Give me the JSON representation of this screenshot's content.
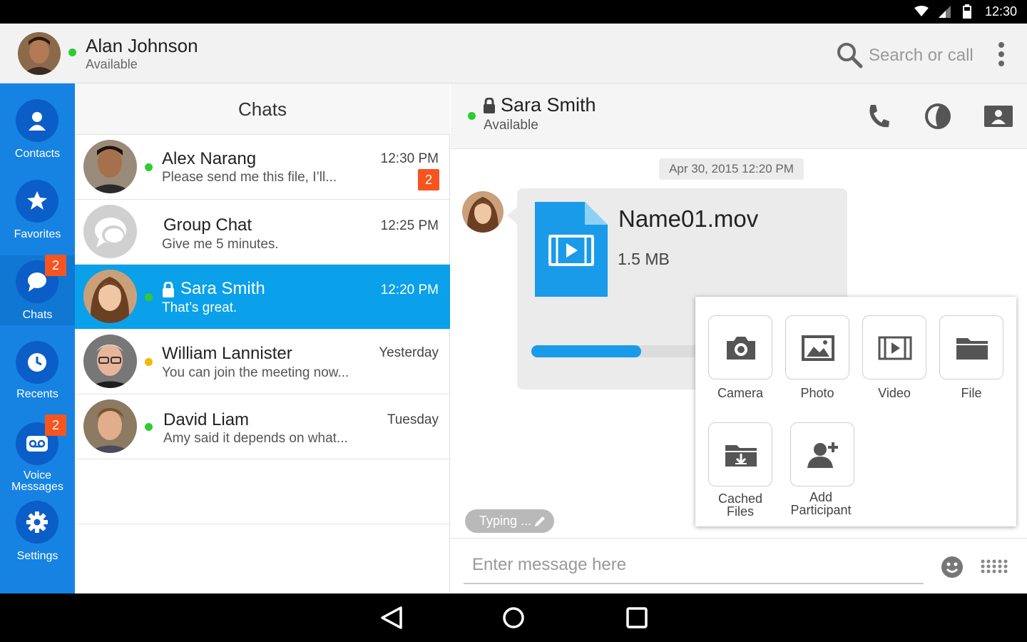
{
  "status_bar": {
    "time": "12:30"
  },
  "me": {
    "name": "Alan Johnson",
    "status": "Available"
  },
  "search": {
    "placeholder": "Search or call"
  },
  "nav": [
    {
      "label": "Contacts"
    },
    {
      "label": "Favorites"
    },
    {
      "label": "Chats",
      "badge": "2"
    },
    {
      "label": "Recents"
    },
    {
      "label": "Voice Messages",
      "badge": "2"
    },
    {
      "label": "Settings"
    }
  ],
  "chats_title": "Chats",
  "chats": [
    {
      "name": "Alex Narang",
      "message": "Please send me this file, I’ll...",
      "time": "12:30 PM",
      "badge": "2"
    },
    {
      "name": "Group Chat",
      "message": "Give me 5 minutes.",
      "time": "12:25 PM"
    },
    {
      "name": "Sara Smith",
      "message": "That’s great.",
      "time": "12:20 PM"
    },
    {
      "name": "William Lannister",
      "message": "You can join the meeting now...",
      "time": "Yesterday"
    },
    {
      "name": "David Liam",
      "message": "Amy said it depends on what...",
      "time": "Tuesday"
    }
  ],
  "conversation": {
    "name": "Sara Smith",
    "status": "Available",
    "date": "Apr 30, 2015 12:20 PM",
    "file": {
      "name": "Name01.mov",
      "size": "1.5 MB",
      "progress": 0.64
    },
    "typing": "Typing ...",
    "input_placeholder": "Enter message here"
  },
  "attach_menu": {
    "camera": "Camera",
    "photo": "Photo",
    "video": "Video",
    "file": "File",
    "cached_1": "Cached",
    "cached_2": "Files",
    "add_1": "Add",
    "add_2": "Participant"
  },
  "colors": {
    "accent": "#1683e2",
    "selected": "#0aa0ea",
    "badge": "#f7541f",
    "online": "#2ecc2e",
    "away": "#f5b800",
    "file_blue": "#1a9bea"
  }
}
